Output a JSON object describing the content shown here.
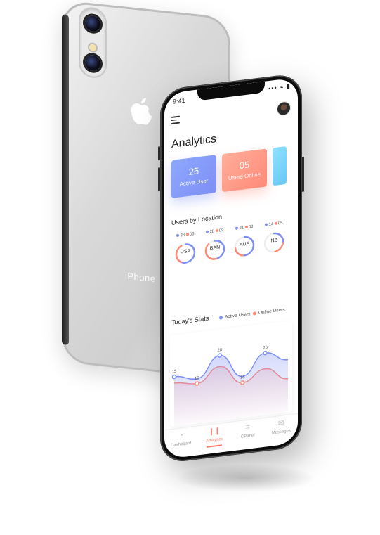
{
  "back_phone": {
    "brand_text": "iPhone"
  },
  "status": {
    "time": "9:41",
    "icons": "••• ⌁ ▮"
  },
  "app": {
    "title": "Analytics"
  },
  "cards": [
    {
      "value": "25",
      "label": "Active User",
      "color": "#7e8ff4"
    },
    {
      "value": "05",
      "label": "Users Online",
      "color": "#ff8a78"
    }
  ],
  "location": {
    "title": "Users by Location",
    "items": [
      {
        "code": "USA",
        "active": "36",
        "online": "06",
        "active_fraction": 0.55,
        "online_fraction": 0.35
      },
      {
        "code": "BAN",
        "active": "28",
        "online": "09",
        "active_fraction": 0.45,
        "online_fraction": 0.4
      },
      {
        "code": "AUS",
        "active": "21",
        "online": "03",
        "active_fraction": 0.5,
        "online_fraction": 0.2
      },
      {
        "code": "NZ",
        "active": "14",
        "online": "05",
        "active_fraction": 0.25,
        "online_fraction": 0.2
      }
    ]
  },
  "stats": {
    "title": "Today's Stats",
    "legend": {
      "active": "Active Users",
      "online": "Online Users"
    },
    "colors": {
      "active": "#7e8ff4",
      "online": "#ff8a78"
    }
  },
  "chart_data": {
    "type": "line",
    "labels": [
      "15",
      "12",
      "28",
      "16",
      "26"
    ],
    "series": [
      {
        "name": "Active Users",
        "values": [
          18,
          15,
          28,
          13,
          26,
          20
        ]
      },
      {
        "name": "Online Users",
        "values": [
          14,
          12,
          21,
          9,
          16,
          8
        ]
      }
    ],
    "ylim": [
      0,
      40
    ]
  },
  "tabs": [
    {
      "label": "Dashboard",
      "icon": "gauge-icon"
    },
    {
      "label": "Analytics",
      "icon": "bar-chart-icon"
    },
    {
      "label": "CPanel",
      "icon": "sliders-icon"
    },
    {
      "label": "Messages",
      "icon": "message-icon"
    }
  ],
  "tab_icons": [
    "◔",
    "❙❙",
    "≡",
    "✉"
  ]
}
